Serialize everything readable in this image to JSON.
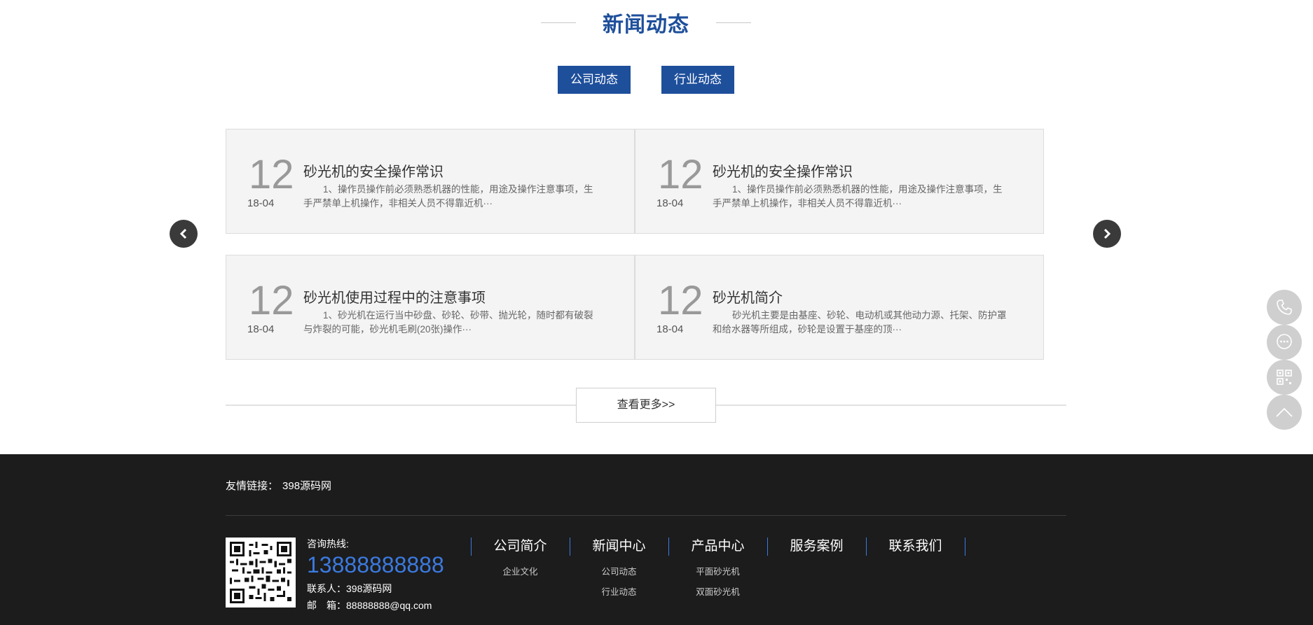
{
  "section": {
    "title": "新闻动态",
    "tabs": [
      "公司动态",
      "行业动态"
    ]
  },
  "news": [
    {
      "day": "12",
      "ym": "18-04",
      "title": "砂光机的安全操作常识",
      "desc": "1、操作员操作前必须熟悉机器的性能，用途及操作注意事项，生手严禁单上机操作，非相关人员不得靠近机···"
    },
    {
      "day": "12",
      "ym": "18-04",
      "title": "砂光机的安全操作常识",
      "desc": "1、操作员操作前必须熟悉机器的性能，用途及操作注意事项，生手严禁单上机操作，非相关人员不得靠近机···"
    },
    {
      "day": "12",
      "ym": "18-04",
      "title": "砂光机使用过程中的注意事项",
      "desc": "1、砂光机在运行当中砂盘、砂轮、砂带、抛光轮，随时都有破裂与炸裂的可能，砂光机毛刷(20张)操作···"
    },
    {
      "day": "12",
      "ym": "18-04",
      "title": "砂光机简介",
      "desc": "砂光机主要是由基座、砂轮、电动机或其他动力源、托架、防护罩和给水器等所组成，砂轮是设置于基座的顶···"
    }
  ],
  "more_label": "查看更多>>",
  "floating": [
    "phone-icon",
    "chat-icon",
    "qrcode-icon",
    "back-to-top-icon"
  ],
  "footer": {
    "links_label": "友情链接：",
    "links": [
      "398源码网"
    ],
    "hotline_label": "咨询热线:",
    "phone": "13888888888",
    "contact_person": "联系人：398源码网",
    "email": "邮　箱：88888888@qq.com",
    "nav": [
      {
        "head": "公司简介",
        "subs": [
          "企业文化"
        ]
      },
      {
        "head": "新闻中心",
        "subs": [
          "公司动态",
          "行业动态"
        ]
      },
      {
        "head": "产品中心",
        "subs": [
          "平面砂光机",
          "双面砂光机"
        ]
      },
      {
        "head": "服务案例",
        "subs": []
      },
      {
        "head": "联系我们",
        "subs": []
      }
    ]
  },
  "colors": {
    "brand": "#1e4f9b",
    "phone": "#3b7ae0",
    "footer_bg": "#1c1c1c"
  }
}
